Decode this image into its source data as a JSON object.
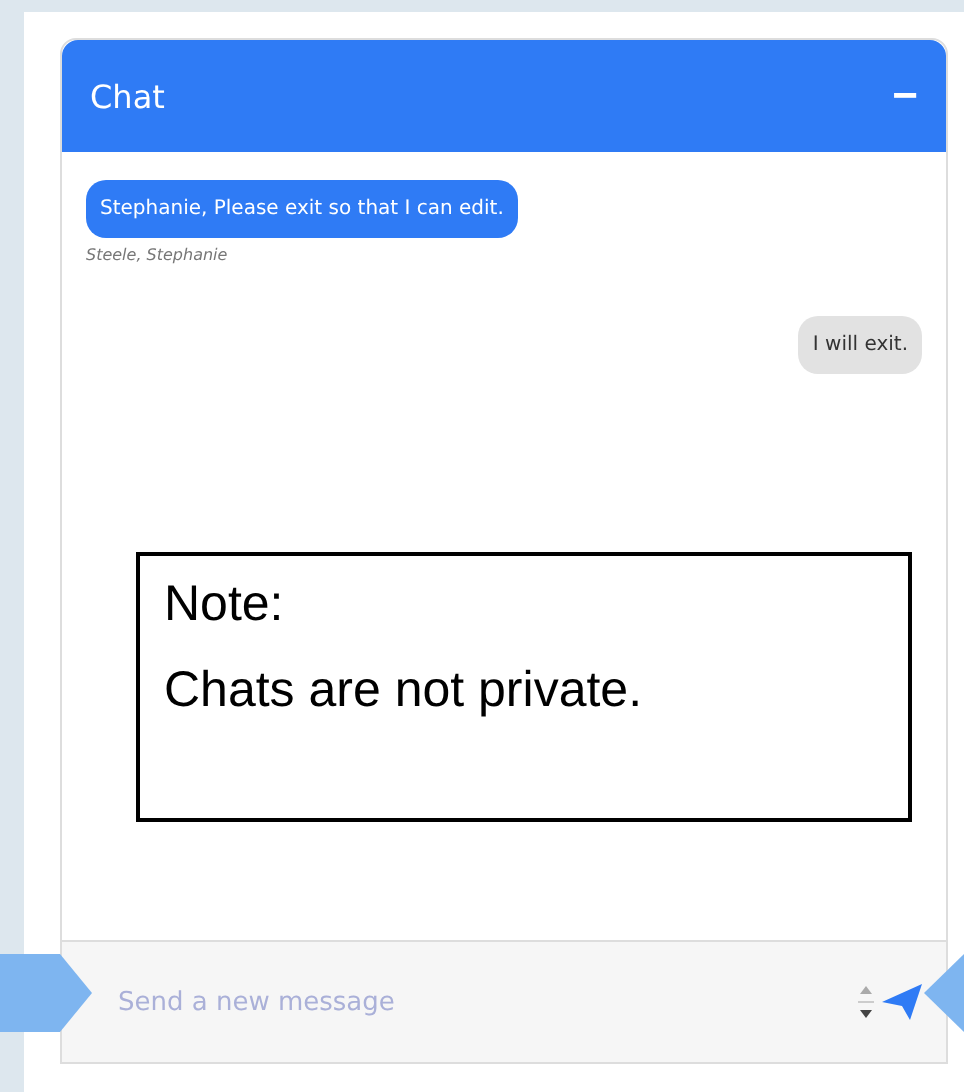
{
  "chat": {
    "title": "Chat",
    "minimize": "−"
  },
  "messages": [
    {
      "kind": "received",
      "text": "Stephanie, Please exit so that I can edit.",
      "author": "Steele, Stephanie"
    },
    {
      "kind": "sent",
      "text": "I will exit."
    }
  ],
  "note": {
    "heading": "Note:",
    "text": "Chats are not private."
  },
  "composer": {
    "placeholder": "Send a new message"
  }
}
